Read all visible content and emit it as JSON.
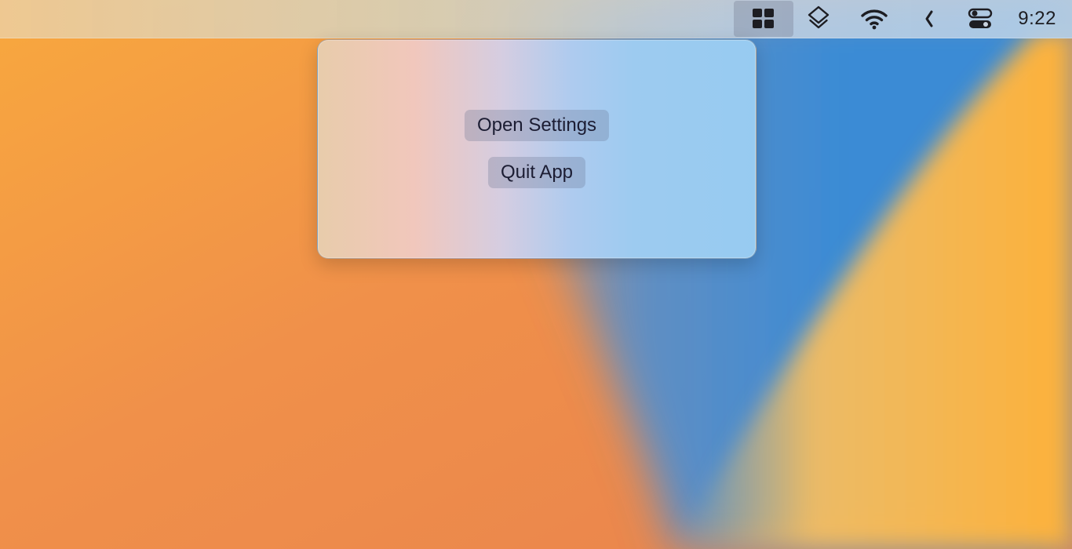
{
  "menubar": {
    "status_items": [
      {
        "icon": "grid-icon",
        "active": true
      },
      {
        "icon": "layers-icon",
        "active": false
      },
      {
        "icon": "wifi-icon",
        "active": false
      },
      {
        "icon": "chevron-left-icon",
        "active": false
      },
      {
        "icon": "control-center-icon",
        "active": false
      }
    ],
    "clock": "9:22"
  },
  "popover": {
    "open_settings_label": "Open Settings",
    "quit_app_label": "Quit App"
  },
  "colors": {
    "wallpaper_orange": "#f59a3a",
    "wallpaper_blue": "#3f8fd6",
    "wallpaper_yellow": "#ffc45c",
    "text_dark": "#1c1d33"
  }
}
